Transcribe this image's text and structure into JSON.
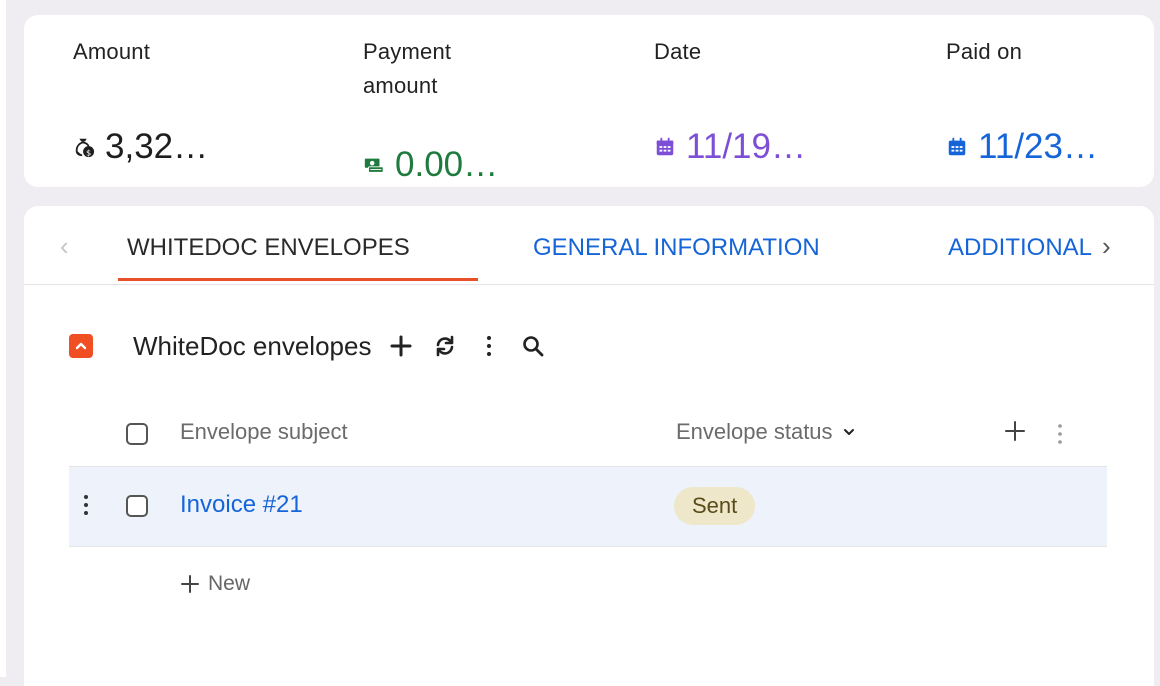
{
  "summary": {
    "amount": {
      "label": "Amount",
      "value": "3,32…",
      "icon": "money-bag-icon"
    },
    "payment_amount": {
      "label_line1": "Payment",
      "label_line2": "amount",
      "value": "0.00…",
      "icon": "cash-stack-icon",
      "color": "#1f7a3e"
    },
    "date": {
      "label": "Date",
      "value": "11/19…",
      "icon": "calendar-icon",
      "color": "#7d4fd6"
    },
    "paid_on": {
      "label": "Paid on",
      "value": "11/23…",
      "icon": "calendar-icon",
      "color": "#1565d8"
    }
  },
  "tabs": {
    "prev": "‹",
    "items": [
      {
        "label": "WHITEDOC ENVELOPES",
        "active": true
      },
      {
        "label": "GENERAL INFORMATION",
        "active": false
      },
      {
        "label": "ADDITIONAL",
        "active": false
      }
    ],
    "next": "›",
    "accent": "#e8502a"
  },
  "section": {
    "title": "WhiteDoc envelopes",
    "tools": [
      "plus-icon",
      "refresh-icon",
      "more-vertical-icon",
      "search-icon"
    ]
  },
  "grid": {
    "columns": [
      {
        "label": "Envelope subject"
      },
      {
        "label": "Envelope status",
        "icon": "chevron-down-icon"
      }
    ],
    "rows": [
      {
        "subject": "Invoice #21",
        "status": "Sent"
      }
    ],
    "new_label": "New"
  }
}
